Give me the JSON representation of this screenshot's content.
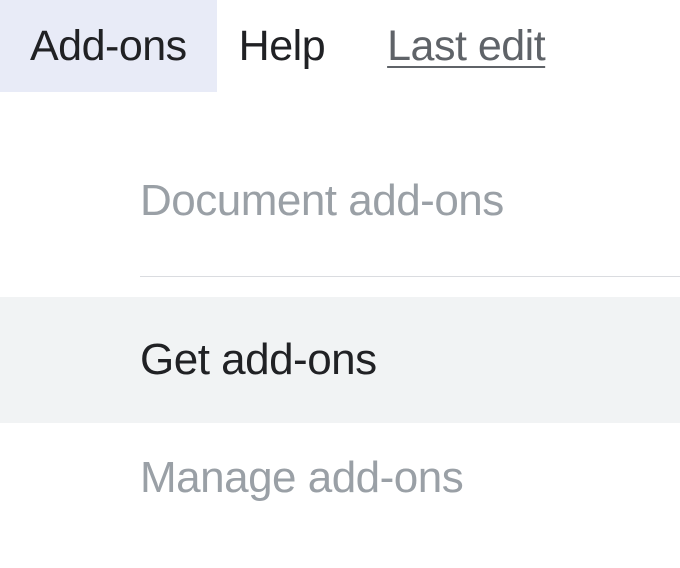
{
  "menubar": {
    "addons": "Add-ons",
    "help": "Help",
    "last_edit": "Last edit"
  },
  "dropdown": {
    "document_addons": "Document add-ons",
    "get_addons": "Get add-ons",
    "manage_addons": "Manage add-ons"
  }
}
